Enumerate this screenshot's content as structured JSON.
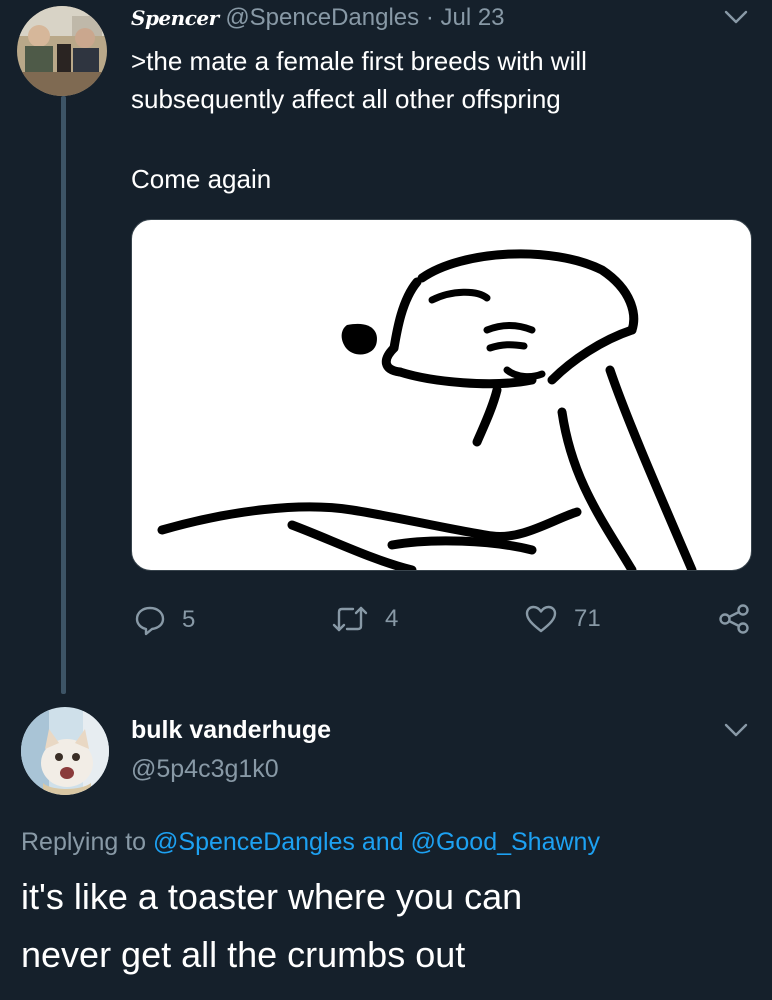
{
  "tweet1": {
    "display_name": "Spencer",
    "handle": "@SpenceDangles",
    "separator": "·",
    "date": "Jul 23",
    "text_line1": ">the mate a female first breeds with will",
    "text_line2": "subsequently affect all other offspring",
    "text_line3": "Come again",
    "counts": {
      "replies": "5",
      "retweets": "4",
      "likes": "71"
    }
  },
  "tweet2": {
    "display_name": "bulk vanderhuge",
    "handle": "@5p4c3g1k0",
    "replying_prefix": "Replying to",
    "replying_user1": "@SpenceDangles",
    "replying_and": "and",
    "replying_user2": "@Good_Shawny",
    "text_line1": "it's like a toaster where you can",
    "text_line2": "never get all the crumbs out"
  },
  "icons": {
    "reply": "reply-icon",
    "retweet": "retweet-icon",
    "like": "heart-icon",
    "share": "share-icon",
    "menu": "chevron-down-icon"
  },
  "colors": {
    "background": "#15202b",
    "muted": "#8899a6",
    "link": "#1da1f2"
  }
}
